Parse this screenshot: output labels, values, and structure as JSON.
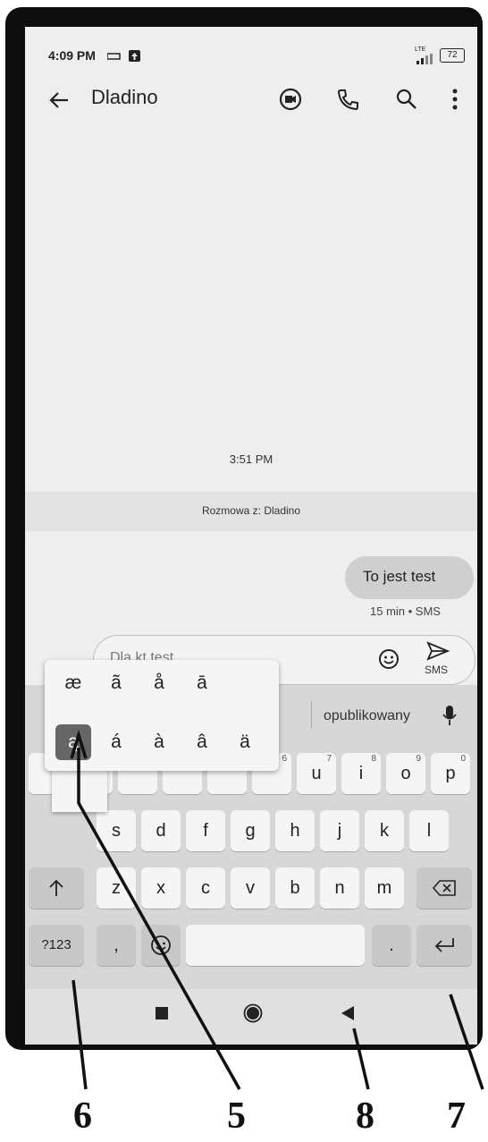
{
  "status_bar": {
    "time": "4:09 PM",
    "network": "LTE",
    "battery": "72"
  },
  "toolbar": {
    "title": "Dladino",
    "back_icon": "arrow-left-icon",
    "video_icon": "video-call-icon",
    "call_icon": "phone-icon",
    "search_icon": "search-icon",
    "menu_icon": "more-vert-icon"
  },
  "conversation": {
    "timestamp": "3:51 PM",
    "banner": "Rozmowa z: Dladino",
    "message": {
      "text": "To jest test",
      "meta": "15 min • SMS"
    }
  },
  "compose": {
    "text": "Dla kt test",
    "send_label": "SMS",
    "emoji_icon": "emoji-icon",
    "send_icon": "send-icon"
  },
  "suggestions": {
    "right": "opublikowany",
    "mic_icon": "mic-icon"
  },
  "accent_popup": {
    "row1": [
      "æ",
      "ã",
      "å",
      "ā"
    ],
    "row2": [
      "ą",
      "á",
      "à",
      "â",
      "ä"
    ]
  },
  "keyboard": {
    "row1": [
      {
        "label": "u",
        "hint": "7"
      },
      {
        "label": "i",
        "hint": "8"
      },
      {
        "label": "o",
        "hint": "9"
      },
      {
        "label": "p",
        "hint": "0"
      }
    ],
    "row1_hidden_hint": "6",
    "row2": [
      "s",
      "d",
      "f",
      "g",
      "h",
      "j",
      "k",
      "l"
    ],
    "row3": [
      "z",
      "x",
      "c",
      "v",
      "b",
      "n",
      "m"
    ],
    "shift_icon": "shift-up-icon",
    "backspace_icon": "backspace-icon",
    "symbols_label": "?123",
    "comma_label": ",",
    "period_label": ".",
    "emoji_key_icon": "emoji-icon",
    "enter_icon": "enter-icon"
  },
  "nav_bar": {
    "recents_icon": "square-icon",
    "home_icon": "circle-icon",
    "back_icon": "triangle-back-icon"
  },
  "callouts": [
    "6",
    "5",
    "8",
    "7"
  ],
  "colors": {
    "screen_bg": "#eeeeee",
    "bubble": "#cfcfcf",
    "selected_accent": "#666666"
  }
}
